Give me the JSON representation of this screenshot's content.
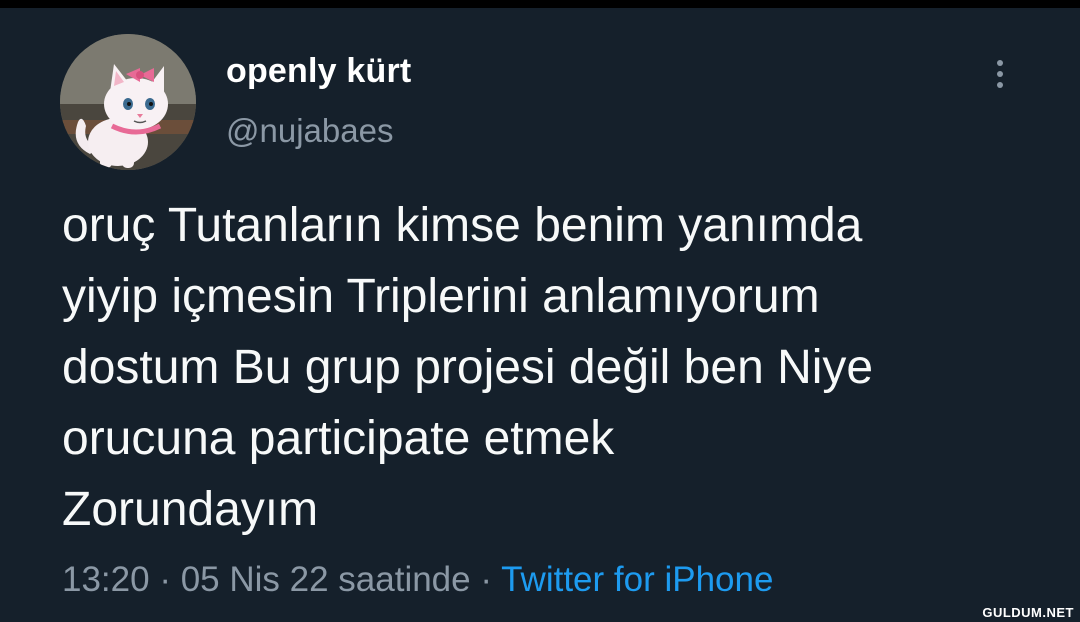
{
  "tweet": {
    "display_name": "openly kürt",
    "handle": "@nujabaes",
    "text_lines": [
      "oruç Tutanların kimse benim yanımda",
      "yiyip içmesin Triplerini anlamıyorum",
      "dostum Bu grup projesi değil ben Niye",
      "orucuna participate etmek",
      "Zorundayım"
    ],
    "time": "13:20",
    "separator": " · ",
    "date": "05 Nis 22 saatinde",
    "source": "Twitter for iPhone",
    "avatar_icon": "cat-avatar-icon",
    "menu_icon": "more-options-icon"
  },
  "watermark": "GULDUM.NET",
  "colors": {
    "background": "#15202b",
    "text": "#f7f9f9",
    "secondary_text": "#8b98a5",
    "link": "#1d9bf0"
  }
}
